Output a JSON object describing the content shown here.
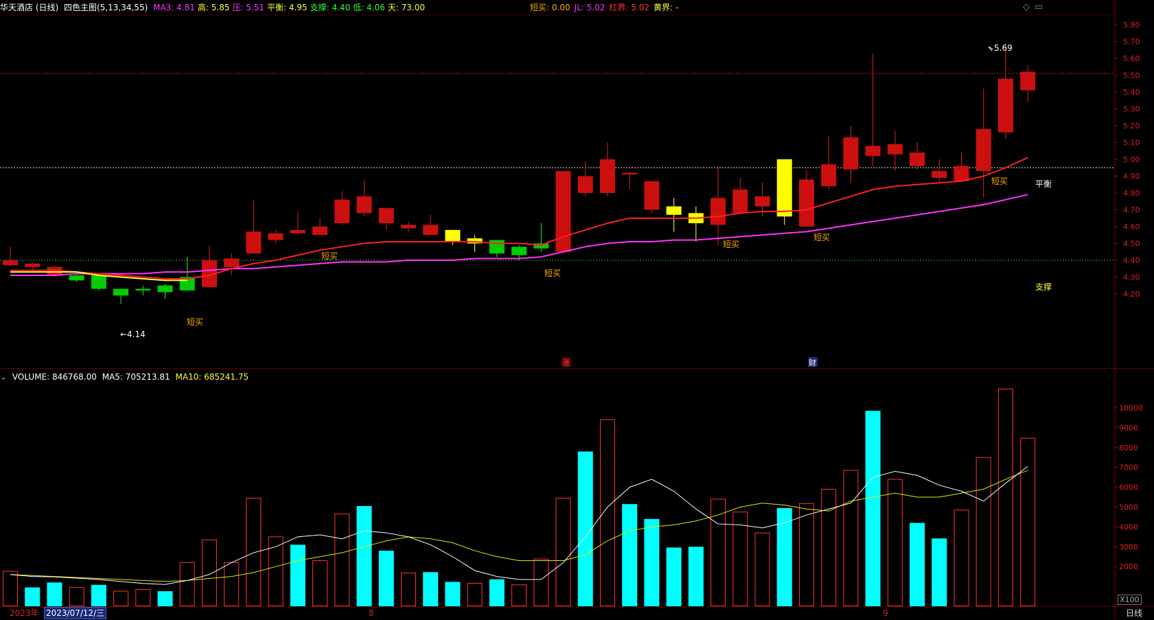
{
  "header": {
    "stock": "华天酒店 (日线)",
    "indicator": "四色主图(5,13,34,55)",
    "items": [
      {
        "label": "MA3: 4.81",
        "color": "#ff33ff"
      },
      {
        "label": "高: 5.85",
        "color": "#ffff33"
      },
      {
        "label": "压: 5.51",
        "color": "#ff33ff"
      },
      {
        "label": "平衡: 4.95",
        "color": "#ffff33"
      },
      {
        "label": "支撑: 4.40",
        "color": "#33ff33"
      },
      {
        "label": "低: 4.06",
        "color": "#33ff33"
      },
      {
        "label": "天: 73.00",
        "color": "#ffff33"
      }
    ],
    "right_items": [
      {
        "label": "短买: 0.00",
        "color": "#ffaa00"
      },
      {
        "label": "JL: 5.02",
        "color": "#ff33ff"
      },
      {
        "label": "红界: 5.02",
        "color": "#ff3333"
      },
      {
        "label": "黄界: -",
        "color": "#ffff33"
      }
    ]
  },
  "price_axis": [
    "5.80",
    "5.70",
    "5.60",
    "5.50",
    "5.40",
    "5.30",
    "5.20",
    "5.10",
    "5.00",
    "4.90",
    "4.80",
    "4.70",
    "4.60",
    "4.50",
    "4.40",
    "4.30",
    "4.20"
  ],
  "volume_axis": [
    "10000",
    "9000",
    "8000",
    "7000",
    "6000",
    "5000",
    "4000",
    "3000",
    "2000"
  ],
  "annotations": {
    "high": "5.69",
    "low": "←4.14",
    "balance": "平衡",
    "support": "支撑",
    "buy_signals": [
      "短买",
      "短买",
      "短买",
      "短买",
      "短买",
      "短买"
    ],
    "event_rise": "涨",
    "event_finance": "财"
  },
  "vol_header": {
    "label": "VOLUME: 846768.00",
    "ma5": "MA5: 705213.81",
    "ma10": "MA10: 685241.75"
  },
  "bottom": {
    "year": "2023年",
    "date": "2023/07/12/三",
    "month8": "8",
    "month9": "9",
    "period": "日线",
    "scale": "X100"
  },
  "chart_data": {
    "type": "candlestick",
    "colors": {
      "up": "#cc1010",
      "down": "#00cc00",
      "balance": "#ffff00",
      "ma_red": "#ff2020",
      "ma_pink": "#ff33ff",
      "vol_up": "#ff3333",
      "vol_down": "#00ffff"
    },
    "candles": [
      {
        "o": 4.4,
        "c": 4.37,
        "h": 4.48,
        "l": 4.37,
        "t": "red"
      },
      {
        "o": 4.38,
        "c": 4.36,
        "h": 4.39,
        "l": 4.34,
        "t": "red"
      },
      {
        "o": 4.36,
        "c": 4.31,
        "h": 4.37,
        "l": 4.3,
        "t": "red"
      },
      {
        "o": 4.31,
        "c": 4.28,
        "h": 4.32,
        "l": 4.27,
        "t": "green"
      },
      {
        "o": 4.31,
        "c": 4.23,
        "h": 4.31,
        "l": 4.22,
        "t": "green"
      },
      {
        "o": 4.23,
        "c": 4.19,
        "h": 4.23,
        "l": 4.14,
        "t": "green"
      },
      {
        "o": 4.23,
        "c": 4.22,
        "h": 4.25,
        "l": 4.19,
        "t": "green"
      },
      {
        "o": 4.25,
        "c": 4.21,
        "h": 4.26,
        "l": 4.17,
        "t": "green"
      },
      {
        "o": 4.3,
        "c": 4.22,
        "h": 4.42,
        "l": 4.22,
        "t": "green"
      },
      {
        "o": 4.24,
        "c": 4.4,
        "h": 4.49,
        "l": 4.24,
        "t": "red"
      },
      {
        "o": 4.36,
        "c": 4.41,
        "h": 4.44,
        "l": 4.31,
        "t": "red"
      },
      {
        "o": 4.44,
        "c": 4.57,
        "h": 4.76,
        "l": 4.44,
        "t": "red"
      },
      {
        "o": 4.52,
        "c": 4.56,
        "h": 4.58,
        "l": 4.5,
        "t": "red"
      },
      {
        "o": 4.56,
        "c": 4.58,
        "h": 4.69,
        "l": 4.55,
        "t": "red"
      },
      {
        "o": 4.55,
        "c": 4.6,
        "h": 4.65,
        "l": 4.55,
        "t": "red"
      },
      {
        "o": 4.62,
        "c": 4.76,
        "h": 4.81,
        "l": 4.61,
        "t": "red"
      },
      {
        "o": 4.68,
        "c": 4.78,
        "h": 4.88,
        "l": 4.66,
        "t": "red"
      },
      {
        "o": 4.62,
        "c": 4.71,
        "h": 4.71,
        "l": 4.58,
        "t": "red"
      },
      {
        "o": 4.59,
        "c": 4.61,
        "h": 4.63,
        "l": 4.57,
        "t": "red"
      },
      {
        "o": 4.55,
        "c": 4.61,
        "h": 4.67,
        "l": 4.55,
        "t": "red"
      },
      {
        "o": 4.58,
        "c": 4.51,
        "h": 4.58,
        "l": 4.49,
        "t": "yellow"
      },
      {
        "o": 4.53,
        "c": 4.5,
        "h": 4.55,
        "l": 4.45,
        "t": "yellow"
      },
      {
        "o": 4.52,
        "c": 4.44,
        "h": 4.52,
        "l": 4.42,
        "t": "green"
      },
      {
        "o": 4.48,
        "c": 4.43,
        "h": 4.49,
        "l": 4.4,
        "t": "green"
      },
      {
        "o": 4.5,
        "c": 4.47,
        "h": 4.62,
        "l": 4.45,
        "t": "green"
      },
      {
        "o": 4.45,
        "c": 4.93,
        "h": 4.93,
        "l": 4.44,
        "t": "red"
      },
      {
        "o": 4.8,
        "c": 4.9,
        "h": 4.99,
        "l": 4.78,
        "t": "red"
      },
      {
        "o": 4.8,
        "c": 5.0,
        "h": 5.1,
        "l": 4.78,
        "t": "red"
      },
      {
        "o": 4.92,
        "c": 4.91,
        "h": 4.92,
        "l": 4.82,
        "t": "red"
      },
      {
        "o": 4.7,
        "c": 4.87,
        "h": 4.87,
        "l": 4.68,
        "t": "red"
      },
      {
        "o": 4.72,
        "c": 4.67,
        "h": 4.77,
        "l": 4.57,
        "t": "yellow"
      },
      {
        "o": 4.68,
        "c": 4.62,
        "h": 4.72,
        "l": 4.51,
        "t": "yellow"
      },
      {
        "o": 4.61,
        "c": 4.77,
        "h": 4.96,
        "l": 4.49,
        "t": "red"
      },
      {
        "o": 4.68,
        "c": 4.82,
        "h": 4.89,
        "l": 4.67,
        "t": "red"
      },
      {
        "o": 4.72,
        "c": 4.78,
        "h": 4.86,
        "l": 4.66,
        "t": "red"
      },
      {
        "o": 5.0,
        "c": 4.66,
        "h": 5.0,
        "l": 4.61,
        "t": "yellow"
      },
      {
        "o": 4.6,
        "c": 4.88,
        "h": 4.94,
        "l": 4.6,
        "t": "red"
      },
      {
        "o": 4.84,
        "c": 4.97,
        "h": 5.14,
        "l": 4.82,
        "t": "red"
      },
      {
        "o": 4.94,
        "c": 5.13,
        "h": 5.2,
        "l": 4.86,
        "t": "red"
      },
      {
        "o": 5.02,
        "c": 5.08,
        "h": 5.63,
        "l": 4.96,
        "t": "red"
      },
      {
        "o": 5.03,
        "c": 5.09,
        "h": 5.17,
        "l": 4.93,
        "t": "red"
      },
      {
        "o": 4.96,
        "c": 5.04,
        "h": 5.1,
        "l": 4.94,
        "t": "red"
      },
      {
        "o": 4.89,
        "c": 4.93,
        "h": 5.0,
        "l": 4.87,
        "t": "red"
      },
      {
        "o": 4.87,
        "c": 4.96,
        "h": 5.04,
        "l": 4.87,
        "t": "red"
      },
      {
        "o": 4.93,
        "c": 5.18,
        "h": 5.42,
        "l": 4.77,
        "t": "red"
      },
      {
        "o": 5.16,
        "c": 5.48,
        "h": 5.69,
        "l": 5.12,
        "t": "red"
      },
      {
        "o": 5.41,
        "c": 5.52,
        "h": 5.56,
        "l": 5.34,
        "t": "red"
      }
    ],
    "ma_red": [
      4.34,
      4.34,
      4.34,
      4.33,
      4.32,
      4.31,
      4.3,
      4.29,
      4.29,
      4.31,
      4.35,
      4.38,
      4.4,
      4.43,
      4.46,
      4.48,
      4.5,
      4.51,
      4.51,
      4.51,
      4.51,
      4.51,
      4.5,
      4.5,
      4.49,
      4.54,
      4.58,
      4.62,
      4.65,
      4.65,
      4.65,
      4.65,
      4.66,
      4.68,
      4.69,
      4.69,
      4.7,
      4.74,
      4.78,
      4.82,
      4.84,
      4.85,
      4.86,
      4.87,
      4.9,
      4.95,
      5.01
    ],
    "ma_pink": [
      4.31,
      4.31,
      4.31,
      4.32,
      4.32,
      4.32,
      4.32,
      4.33,
      4.33,
      4.34,
      4.35,
      4.35,
      4.36,
      4.37,
      4.38,
      4.39,
      4.39,
      4.39,
      4.4,
      4.4,
      4.4,
      4.41,
      4.41,
      4.41,
      4.42,
      4.45,
      4.48,
      4.5,
      4.51,
      4.51,
      4.52,
      4.52,
      4.53,
      4.54,
      4.55,
      4.56,
      4.57,
      4.59,
      4.61,
      4.63,
      4.65,
      4.67,
      4.69,
      4.71,
      4.73,
      4.76,
      4.79
    ],
    "ma_yellow": [
      4.33,
      4.33,
      4.33,
      4.33,
      4.31,
      4.3,
      4.29,
      4.28,
      4.28
    ],
    "volume": [
      {
        "v": 1760,
        "t": "up"
      },
      {
        "v": 950,
        "t": "down"
      },
      {
        "v": 1200,
        "t": "down"
      },
      {
        "v": 950,
        "t": "up"
      },
      {
        "v": 1080,
        "t": "down"
      },
      {
        "v": 760,
        "t": "up"
      },
      {
        "v": 850,
        "t": "up"
      },
      {
        "v": 760,
        "t": "down"
      },
      {
        "v": 2200,
        "t": "up"
      },
      {
        "v": 3350,
        "t": "up"
      },
      {
        "v": 2200,
        "t": "up"
      },
      {
        "v": 5450,
        "t": "up"
      },
      {
        "v": 3500,
        "t": "up"
      },
      {
        "v": 3100,
        "t": "down"
      },
      {
        "v": 2300,
        "t": "up"
      },
      {
        "v": 4650,
        "t": "up"
      },
      {
        "v": 5050,
        "t": "down"
      },
      {
        "v": 2800,
        "t": "down"
      },
      {
        "v": 1680,
        "t": "up"
      },
      {
        "v": 1720,
        "t": "down"
      },
      {
        "v": 1230,
        "t": "down"
      },
      {
        "v": 1160,
        "t": "up"
      },
      {
        "v": 1360,
        "t": "down"
      },
      {
        "v": 1080,
        "t": "up"
      },
      {
        "v": 2380,
        "t": "up"
      },
      {
        "v": 5450,
        "t": "up"
      },
      {
        "v": 7800,
        "t": "down"
      },
      {
        "v": 9400,
        "t": "up"
      },
      {
        "v": 5150,
        "t": "down"
      },
      {
        "v": 4400,
        "t": "down"
      },
      {
        "v": 2960,
        "t": "down"
      },
      {
        "v": 3000,
        "t": "down"
      },
      {
        "v": 5400,
        "t": "up"
      },
      {
        "v": 4750,
        "t": "up"
      },
      {
        "v": 3700,
        "t": "up"
      },
      {
        "v": 4950,
        "t": "down"
      },
      {
        "v": 5180,
        "t": "up"
      },
      {
        "v": 5900,
        "t": "up"
      },
      {
        "v": 6850,
        "t": "up"
      },
      {
        "v": 9850,
        "t": "down"
      },
      {
        "v": 6400,
        "t": "up"
      },
      {
        "v": 4200,
        "t": "down"
      },
      {
        "v": 3420,
        "t": "down"
      },
      {
        "v": 4850,
        "t": "up"
      },
      {
        "v": 7500,
        "t": "up"
      },
      {
        "v": 10950,
        "t": "up"
      },
      {
        "v": 8470,
        "t": "up"
      }
    ],
    "vol_ma5": [
      1600,
      1500,
      1480,
      1420,
      1350,
      1250,
      1150,
      1100,
      1300,
      1600,
      2200,
      2700,
      3000,
      3500,
      3600,
      3400,
      3800,
      3700,
      3500,
      3100,
      2500,
      1800,
      1500,
      1350,
      1350,
      2200,
      3500,
      5000,
      6000,
      6400,
      5800,
      4900,
      4150,
      4100,
      3950,
      4200,
      4600,
      4900,
      5200,
      6500,
      6800,
      6600,
      6100,
      5800,
      5300,
      6200,
      7050
    ],
    "vol_ma10": [
      1600,
      1550,
      1500,
      1450,
      1400,
      1350,
      1300,
      1250,
      1300,
      1400,
      1500,
      1700,
      2000,
      2300,
      2500,
      2700,
      3000,
      3300,
      3500,
      3400,
      3200,
      2800,
      2500,
      2300,
      2300,
      2300,
      2600,
      3300,
      3800,
      4000,
      4100,
      4300,
      4600,
      5000,
      5200,
      5100,
      4900,
      4800,
      5300,
      5500,
      5700,
      5500,
      5500,
      5700,
      5900,
      6400,
      6850
    ],
    "ylim_price": [
      4.1,
      5.9
    ],
    "ylim_volume": [
      0,
      11000
    ]
  }
}
